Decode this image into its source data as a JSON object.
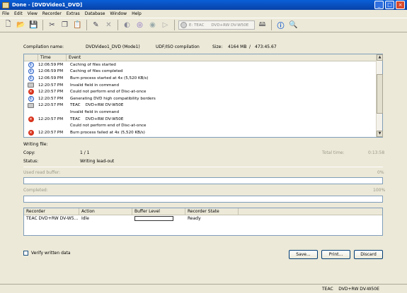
{
  "window": {
    "title": "Done - [DVDVideo1_DVD]",
    "controls": [
      "_",
      "□",
      "×"
    ]
  },
  "menu": [
    "File",
    "Edit",
    "View",
    "Recorder",
    "Extras",
    "Database",
    "Window",
    "Help"
  ],
  "toolbar": {
    "icons": [
      "new-icon",
      "open-icon",
      "save-icon",
      "cut-icon",
      "copy-icon",
      "paste-icon",
      "burn-icon",
      "erase-icon",
      "burn-settings-icon",
      "disc-info-icon",
      "disc-icon",
      "eject-icon",
      "drive-icon",
      "info-icon",
      "help-icon"
    ],
    "drive_letter": "E: TEAC",
    "drive_name": "DVD+RW DV-W50E"
  },
  "compilation": {
    "name_label": "Compilation name:",
    "name_value": "DVDVideo1_DVD (Mode1)",
    "type": "UDF/ISO compilation",
    "size_label": "Size:",
    "size_value": "4164 MB",
    "time_value": "473:45.67"
  },
  "log": {
    "columns": [
      "Time",
      "Event"
    ],
    "rows": [
      {
        "icon": "info",
        "time": "12:06:59 PM",
        "event": "Caching of files started"
      },
      {
        "icon": "info",
        "time": "12:06:59 PM",
        "event": "Caching of files completed"
      },
      {
        "icon": "info",
        "time": "12:06:59 PM",
        "event": "Burn process started at 4x (5,520 KB/s)"
      },
      {
        "icon": "drive",
        "time": "12:20:57 PM",
        "event": "Invalid field in command"
      },
      {
        "icon": "error",
        "time": "12:20:57 PM",
        "event": "Could not perform end of Disc-at-once"
      },
      {
        "icon": "info",
        "time": "12:20:57 PM",
        "event": "Generating DVD high compatibility borders"
      },
      {
        "icon": "drive",
        "time": "12:20:57 PM",
        "event": "TEAC    DVD+RW DV-W50E"
      },
      {
        "icon": "",
        "time": "",
        "event": "Invalid field in command"
      },
      {
        "icon": "error",
        "time": "12:20:57 PM",
        "event": "TEAC    DVD+RW DV-W50E"
      },
      {
        "icon": "",
        "time": "",
        "event": "Could not perform end of Disc-at-once"
      },
      {
        "icon": "error",
        "time": "12:20:57 PM",
        "event": "Burn process failed at 4x (5,520 KB/s)"
      }
    ]
  },
  "status": {
    "writing_file_label": "Writing file:",
    "copy_label": "Copy:",
    "copy_value": "1 / 1",
    "total_time_label": "Total time:",
    "total_time_value": "0:13:58",
    "status_label": "Status:",
    "status_value": "Writing lead-out",
    "buffer_label": "Used read buffer:",
    "buffer_value": "0%",
    "buffer_fraction": 0,
    "completed_label": "Completed:",
    "completed_value": "100%",
    "completed_fraction": 1
  },
  "recorders": {
    "columns": [
      "Recorder",
      "Action",
      "Buffer Level",
      "Recorder State"
    ],
    "rows": [
      {
        "recorder": "TEAC DVD+RW DV-W5...",
        "action": "Idle",
        "state": "Ready"
      }
    ]
  },
  "verify_label": "Verify written data",
  "buttons": {
    "save": "Save...",
    "print": "Print...",
    "discard": "Discard"
  },
  "statusbar": {
    "drive": "TEAC    DVD+RW DV-W50E"
  }
}
